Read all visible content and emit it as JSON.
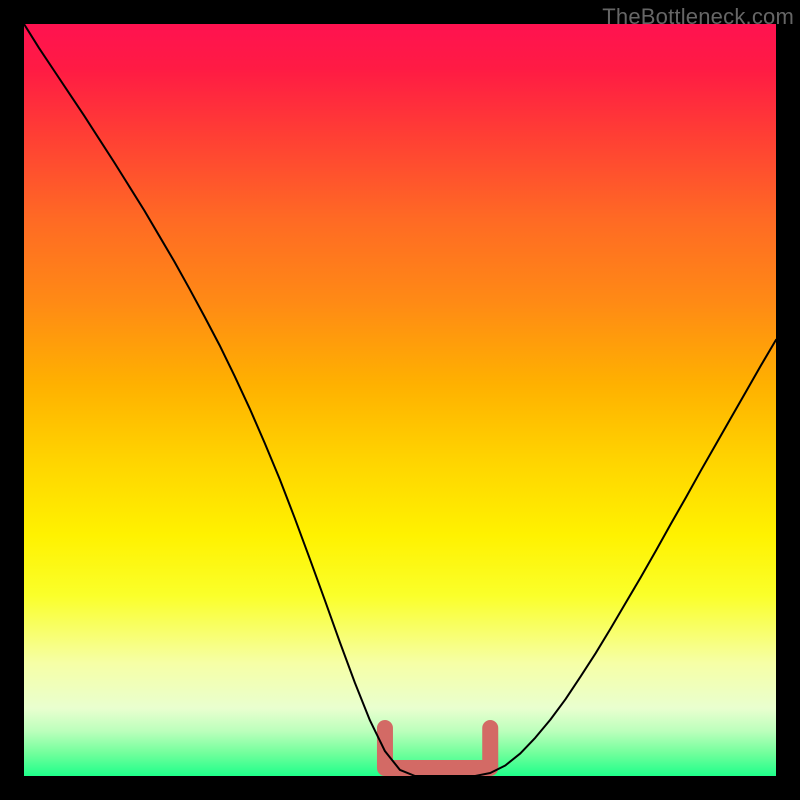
{
  "watermark": "TheBottleneck.com",
  "colors": {
    "background": "#000000",
    "curve": "#000000",
    "patch": "#d36a65",
    "gradient_top": "#ff1250",
    "gradient_bottom": "#1fff8a"
  },
  "chart_data": {
    "type": "line",
    "title": "",
    "xlabel": "",
    "ylabel": "",
    "xlim": [
      0,
      100
    ],
    "ylim": [
      0,
      100
    ],
    "x": [
      0,
      2,
      4,
      6,
      8,
      10,
      12,
      14,
      16,
      18,
      20,
      22,
      24,
      26,
      28,
      30,
      32,
      34,
      36,
      38,
      40,
      42,
      44,
      46,
      48,
      50,
      52,
      54,
      56,
      58,
      60,
      62,
      64,
      66,
      68,
      70,
      72,
      74,
      76,
      78,
      80,
      82,
      84,
      86,
      88,
      90,
      92,
      94,
      96,
      98,
      100
    ],
    "values": [
      100.0,
      96.8,
      93.8,
      90.8,
      87.8,
      84.7,
      81.6,
      78.4,
      75.2,
      71.8,
      68.4,
      64.8,
      61.1,
      57.3,
      53.2,
      48.9,
      44.3,
      39.5,
      34.3,
      28.9,
      23.4,
      17.8,
      12.4,
      7.4,
      3.3,
      0.8,
      0.0,
      0.0,
      0.0,
      0.0,
      0.0,
      0.4,
      1.4,
      3.0,
      5.1,
      7.5,
      10.2,
      13.2,
      16.3,
      19.6,
      23.0,
      26.4,
      29.9,
      33.5,
      37.0,
      40.6,
      44.1,
      47.6,
      51.1,
      54.6,
      58.0
    ],
    "annotations": [
      {
        "kind": "patch",
        "x_start": 48,
        "x_end": 62,
        "note": "highlighted flat minimum region"
      }
    ]
  }
}
